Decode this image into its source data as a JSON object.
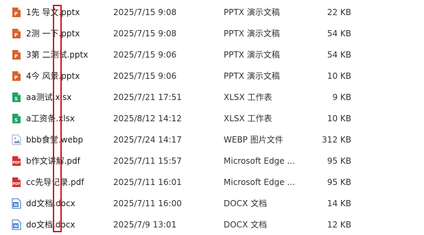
{
  "files": [
    {
      "name": "1先 导文.pptx",
      "date": "2025/7/15 9:08",
      "type": "PPTX 演示文稿",
      "size": "22 KB",
      "icon": "pptx-file-icon"
    },
    {
      "name": "2测  一下.pptx",
      "date": "2025/7/15 9:08",
      "type": "PPTX 演示文稿",
      "size": "54 KB",
      "icon": "pptx-file-icon"
    },
    {
      "name": "3第 二测试.pptx",
      "date": "2025/7/15 9:06",
      "type": "PPTX 演示文稿",
      "size": "54 KB",
      "icon": "pptx-file-icon"
    },
    {
      "name": "4今 风景.pptx",
      "date": "2025/7/15 9:06",
      "type": "PPTX 演示文稿",
      "size": "10 KB",
      "icon": "pptx-file-icon"
    },
    {
      "name": "aa测试.xlsx",
      "date": "2025/7/21 17:51",
      "type": "XLSX 工作表",
      "size": "9 KB",
      "icon": "xlsx-file-icon"
    },
    {
      "name": "a工资条.xlsx",
      "date": "2025/8/12 14:12",
      "type": "XLSX 工作表",
      "size": "10 KB",
      "icon": "xlsx-file-icon"
    },
    {
      "name": "bbb食堂.webp",
      "date": "2025/7/24 14:17",
      "type": "WEBP 图片文件",
      "size": "312 KB",
      "icon": "image-file-icon"
    },
    {
      "name": "b作文讲解.pdf",
      "date": "2025/7/11 15:57",
      "type": "Microsoft Edge ...",
      "size": "95 KB",
      "icon": "pdf-file-icon"
    },
    {
      "name": "cc先导记录.pdf",
      "date": "2025/7/11 16:01",
      "type": "Microsoft Edge ...",
      "size": "95 KB",
      "icon": "pdf-file-icon"
    },
    {
      "name": "dd文档.docx",
      "date": "2025/7/11 16:00",
      "type": "DOCX 文档",
      "size": "14 KB",
      "icon": "docx-file-icon"
    },
    {
      "name": "do文档.docx",
      "date": "2025/7/9 13:01",
      "type": "DOCX 文档",
      "size": "12 KB",
      "icon": "docx-file-icon"
    }
  ],
  "colors": {
    "pptx": "#d9622b",
    "xlsx": "#21a366",
    "pdf": "#d32f2f",
    "docx": "#2b6cc4",
    "image": "#7a8fb8",
    "highlight": "#d6131b"
  }
}
